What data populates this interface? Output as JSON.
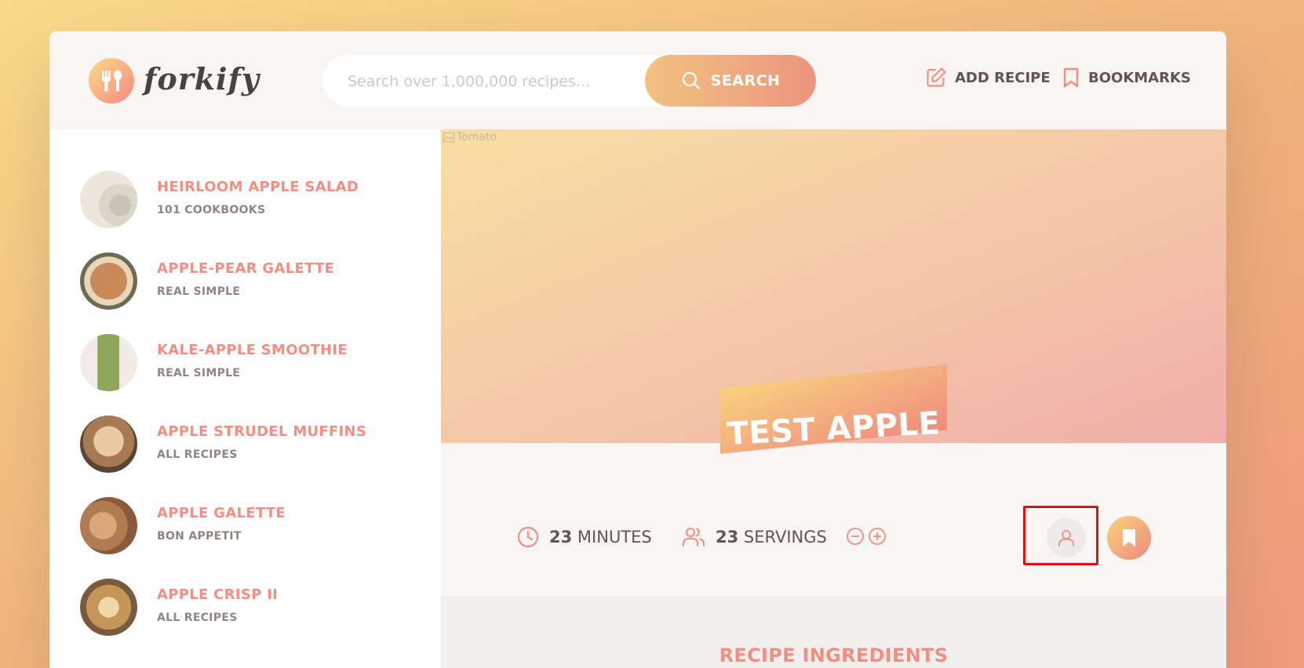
{
  "app": {
    "name": "forkify"
  },
  "search": {
    "placeholder": "Search over 1,000,000 recipes...",
    "button_label": "SEARCH"
  },
  "nav": {
    "add_recipe": "ADD RECIPE",
    "bookmarks": "BOOKMARKS"
  },
  "results": [
    {
      "title": "HEIRLOOM APPLE SALAD",
      "publisher": "101 COOKBOOKS"
    },
    {
      "title": "APPLE-PEAR GALETTE",
      "publisher": "REAL SIMPLE"
    },
    {
      "title": "KALE-APPLE SMOOTHIE",
      "publisher": "REAL SIMPLE"
    },
    {
      "title": "APPLE STRUDEL MUFFINS",
      "publisher": "ALL RECIPES"
    },
    {
      "title": "APPLE GALETTE",
      "publisher": "BON APPETIT"
    },
    {
      "title": "APPLE CRISP II",
      "publisher": "ALL RECIPES"
    }
  ],
  "recipe": {
    "image_alt": "Tomato",
    "title": "TEST APPLE",
    "minutes": "23",
    "minutes_label": "MINUTES",
    "servings": "23",
    "servings_label": "SERVINGS",
    "ingredients_heading": "RECIPE INGREDIENTS"
  },
  "colors": {
    "accent": "#f38e82",
    "brand_gradient_start": "#fbdb89",
    "brand_gradient_end": "#f48982"
  }
}
